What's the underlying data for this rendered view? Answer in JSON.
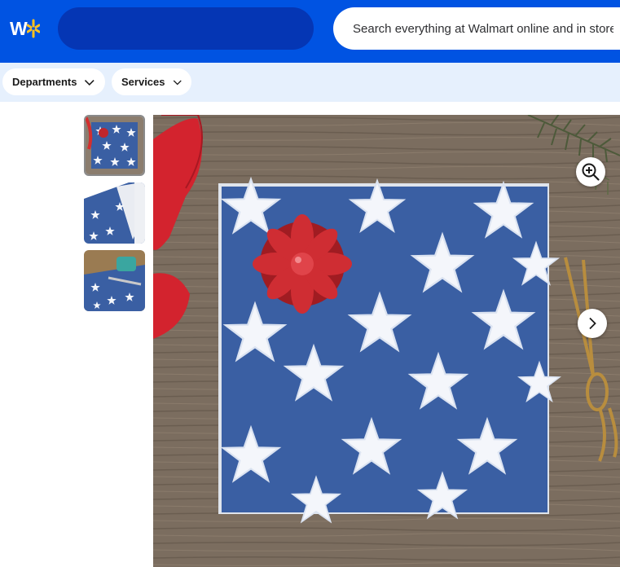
{
  "header": {
    "brand_color": "#0053e2",
    "logo_letter": "W",
    "store_selector_color": "#0536b4",
    "search": {
      "placeholder": "Search everything at Walmart online and in store",
      "value": ""
    }
  },
  "subnav": {
    "background": "#e6f0fd",
    "items": [
      {
        "label": "Departments",
        "icon": "chevron-down-icon"
      },
      {
        "label": "Services",
        "icon": "chevron-down-icon"
      }
    ]
  },
  "gallery": {
    "thumbnails": [
      {
        "label": "wrapped-box-with-bow",
        "selected": true
      },
      {
        "label": "paper-roll",
        "selected": false
      },
      {
        "label": "paper-with-scissors-and-tape",
        "selected": false
      }
    ],
    "main_image": "blue-star-wrapping-paper-gift-box-with-red-bow",
    "controls": [
      "zoom-in-icon",
      "chevron-right-icon"
    ]
  },
  "colors": {
    "paper_blue": "#3a5fa3",
    "star_white": "#f4f6fb",
    "bow_red": "#c0262c",
    "wood": "#7b6d5f"
  }
}
